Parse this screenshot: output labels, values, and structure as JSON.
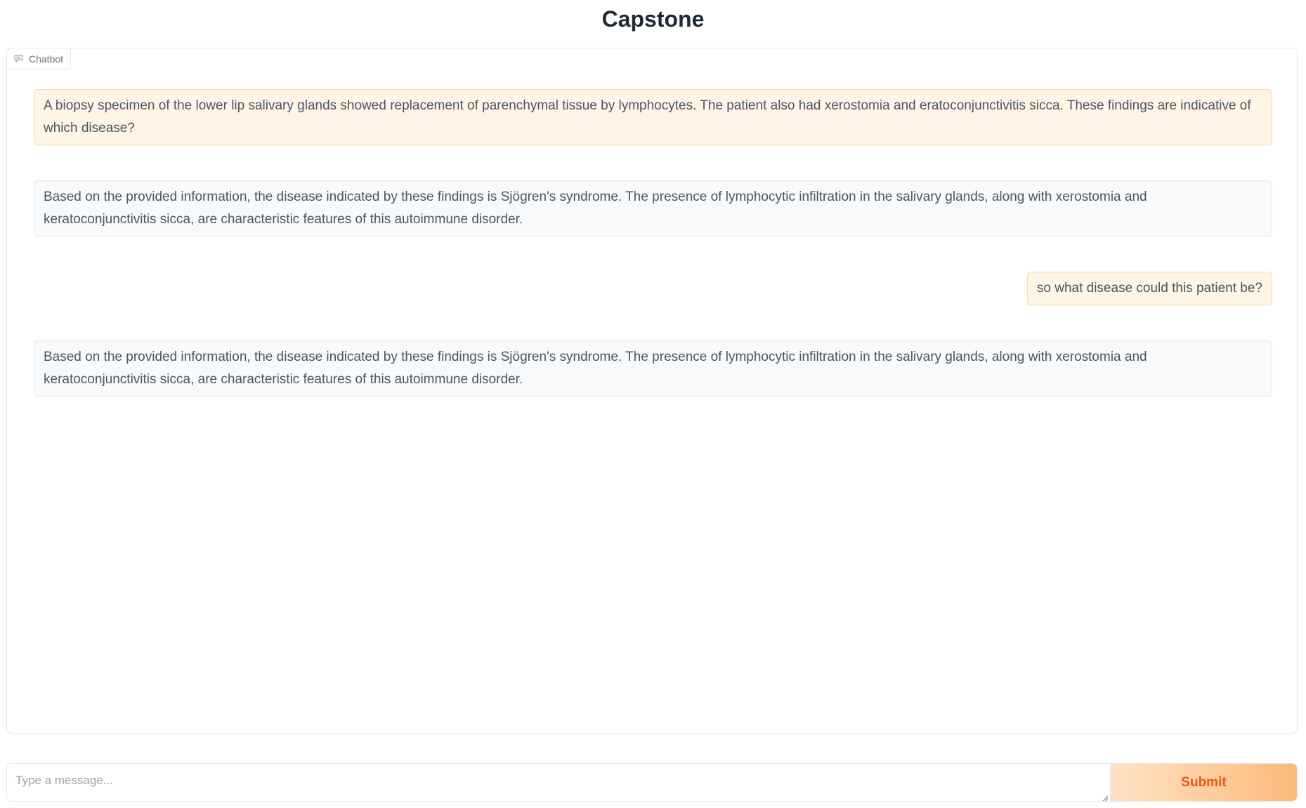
{
  "page_title": "Capstone",
  "chatbot": {
    "label": "Chatbot",
    "messages": [
      {
        "role": "user",
        "text": "A biopsy specimen of the lower lip salivary glands showed replacement of parenchymal tissue by lymphocytes. The patient also had xerostomia and eratoconjunctivitis sicca. These findings are indicative of which disease?"
      },
      {
        "role": "bot",
        "text": "Based on the provided information, the disease indicated by these findings is Sjögren's syndrome. The presence of lymphocytic infiltration in the salivary glands, along with xerostomia and keratoconjunctivitis sicca, are characteristic features of this autoimmune disorder."
      },
      {
        "role": "user",
        "text": "so what disease could this patient be?"
      },
      {
        "role": "bot",
        "text": "Based on the provided information, the disease indicated by these findings is Sjögren's syndrome. The presence of lymphocytic infiltration in the salivary glands, along with xerostomia and keratoconjunctivitis sicca, are characteristic features of this autoimmune disorder."
      }
    ]
  },
  "input": {
    "placeholder": "Type a message...",
    "value": ""
  },
  "submit_label": "Submit",
  "colors": {
    "user_bubble": "#fff4e6",
    "bot_bubble": "#f8f9fb",
    "accent": "#ea580c"
  },
  "icons": {
    "chatbot_label_icon": "chat-bubble-icon",
    "resize_handle": "resize-handle-icon"
  }
}
